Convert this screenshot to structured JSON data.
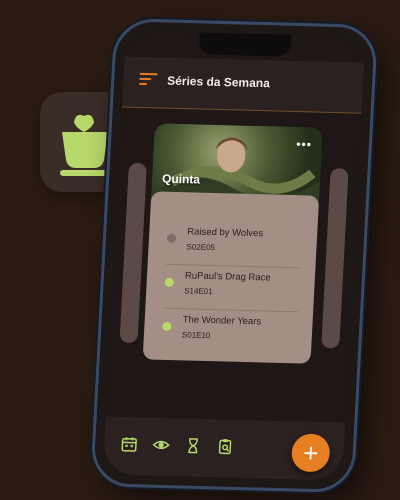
{
  "app": {
    "title": "Séries da Semana",
    "icon_name": "coffee-cup-icon"
  },
  "colors": {
    "background": "#2b1b12",
    "accent": "#e67e22",
    "icon_green": "#b7d86b",
    "panel": "#a38f85"
  },
  "poster": {
    "day_label": "Quinta",
    "more_icon": "more-dots-icon"
  },
  "episodes": [
    {
      "title": "Raised by Wolves",
      "code": "S02E05",
      "watched": false
    },
    {
      "title": "RuPaul's Drag Race",
      "code": "S14E01",
      "watched": true
    },
    {
      "title": "The Wonder Years",
      "code": "S01E10",
      "watched": true
    }
  ],
  "bottom_nav": {
    "items": [
      {
        "icon": "calendar-icon"
      },
      {
        "icon": "eye-icon"
      },
      {
        "icon": "hourglass-icon"
      },
      {
        "icon": "clipboard-search-icon"
      }
    ],
    "fab_label": "+"
  }
}
